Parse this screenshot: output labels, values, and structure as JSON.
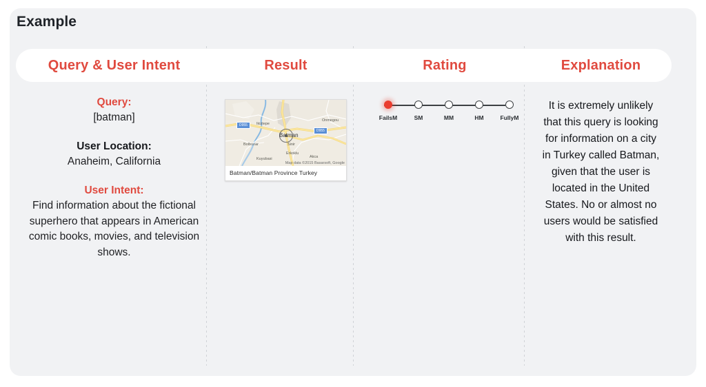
{
  "slide": {
    "title": "Example",
    "accent_color": "#e04a3f",
    "card_background": "#f1f2f4",
    "page_background": "#ffffff"
  },
  "table": {
    "headers": [
      {
        "label": "Query & User Intent"
      },
      {
        "label": "Result"
      },
      {
        "label": "Rating"
      },
      {
        "label": "Explanation"
      }
    ]
  },
  "query_column": {
    "query_label": "Query:",
    "query_value": "[batman]",
    "user_location_label": "User Location:",
    "user_location_value": "Anaheim, California",
    "user_intent_label": "User Intent:",
    "user_intent_value": "Find information about the fictional superhero that appears in American comic books, movies, and television shows."
  },
  "result_column": {
    "map": {
      "caption": "Batman/Batman Province Turkey",
      "attribution": "Map data ©2015 Basarsoft, Google",
      "city_label": "Batman",
      "place_labels": [
        "Ikiztepe",
        "Bolbonar",
        "Kuyubasi",
        "Sinir",
        "Erkoklu",
        "Akca",
        "Onmegou"
      ],
      "road_shields": [
        "D955",
        "D955"
      ]
    }
  },
  "rating_column": {
    "selected_index": 0,
    "points": [
      {
        "label": "FailsM"
      },
      {
        "label": "SM"
      },
      {
        "label": "MM"
      },
      {
        "label": "HM"
      },
      {
        "label": "FullyM"
      }
    ],
    "selected_color": "#ea3d2f"
  },
  "explanation_column": {
    "text": "It is extremely unlikely that this query is looking for information on a city in Turkey called Batman, given that the user is located in the United States. No or almost no users would be satisfied with this result."
  }
}
